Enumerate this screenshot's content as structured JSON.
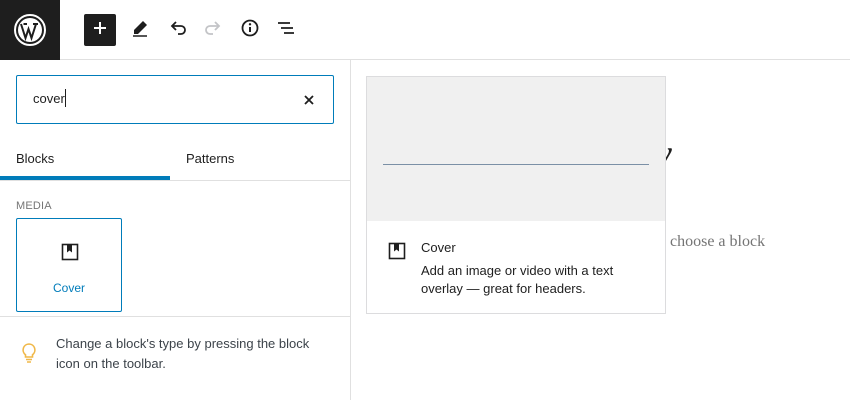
{
  "toolbar": {
    "logo_icon": "wordpress-logo-icon",
    "add_icon": "plus-icon",
    "edit_icon": "pencil-icon",
    "undo_icon": "undo-icon",
    "redo_icon": "redo-icon",
    "info_icon": "info-icon",
    "list_icon": "list-view-icon"
  },
  "inserter": {
    "search": {
      "value": "cover",
      "clear_icon": "close-icon"
    },
    "tabs": [
      {
        "label": "Blocks",
        "active": true
      },
      {
        "label": "Patterns",
        "active": false
      }
    ],
    "category": "MEDIA",
    "blocks": [
      {
        "label": "Cover",
        "icon": "cover-block-icon"
      }
    ],
    "tip": {
      "icon": "lightbulb-icon",
      "text": "Change a block's type by pressing the block icon on the toolbar."
    }
  },
  "preview": {
    "icon": "cover-block-icon",
    "name": "Cover",
    "description": "Add an image or video with a text overlay — great for headers."
  },
  "canvas": {
    "title_fragment": "y",
    "hint_fragment": "o choose a block"
  },
  "colors": {
    "accent": "#007cba",
    "dark": "#1e1e1e",
    "tip_icon": "#f0b849"
  }
}
